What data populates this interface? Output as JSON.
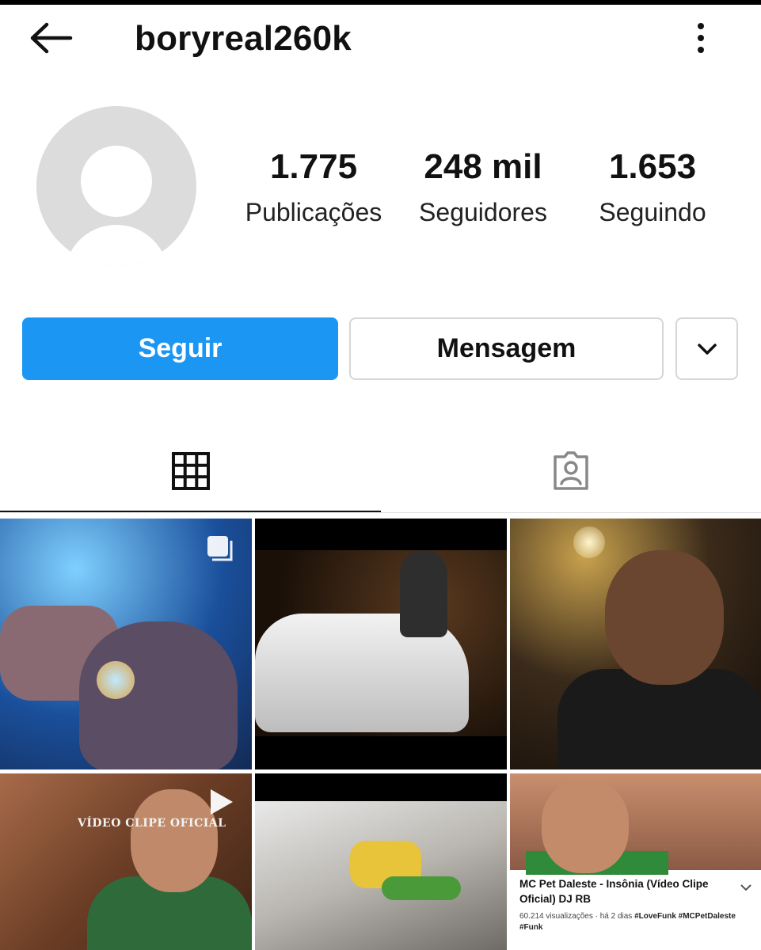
{
  "header": {
    "username": "boryreal260k",
    "back_icon": "arrow-left-icon",
    "more_icon": "more-vertical-icon"
  },
  "profile": {
    "avatar_icon": "default-avatar-icon",
    "stats": {
      "posts": {
        "value": "1.775",
        "label": "Publicações"
      },
      "followers": {
        "value": "248 mil",
        "label": "Seguidores"
      },
      "following": {
        "value": "1.653",
        "label": "Seguindo"
      }
    }
  },
  "actions": {
    "follow_label": "Seguir",
    "message_label": "Mensagem",
    "more_icon": "chevron-down-icon",
    "accent_color": "#1b97f3"
  },
  "tabs": [
    {
      "name": "posts-grid",
      "icon": "grid-icon",
      "active": true
    },
    {
      "name": "tagged",
      "icon": "tagged-user-icon",
      "active": false
    }
  ],
  "posts": [
    {
      "caption": "",
      "badge": "multi-photo-icon"
    },
    {
      "caption": "",
      "badge": ""
    },
    {
      "caption": "",
      "badge": ""
    },
    {
      "caption": "VÍDEO CLIPE OFICIAL",
      "badge": "play-icon"
    },
    {
      "caption": "",
      "badge": ""
    },
    {
      "caption": "",
      "badge": "",
      "youtube": {
        "title": "MC Pet Daleste  - Insônia (Vídeo Clipe Oficial) DJ RB",
        "meta_views": "60.214 visualizações · há 2 dias",
        "meta_tags": "#LoveFunk #MCPetDaleste",
        "meta_tags2": "#Funk"
      }
    }
  ]
}
